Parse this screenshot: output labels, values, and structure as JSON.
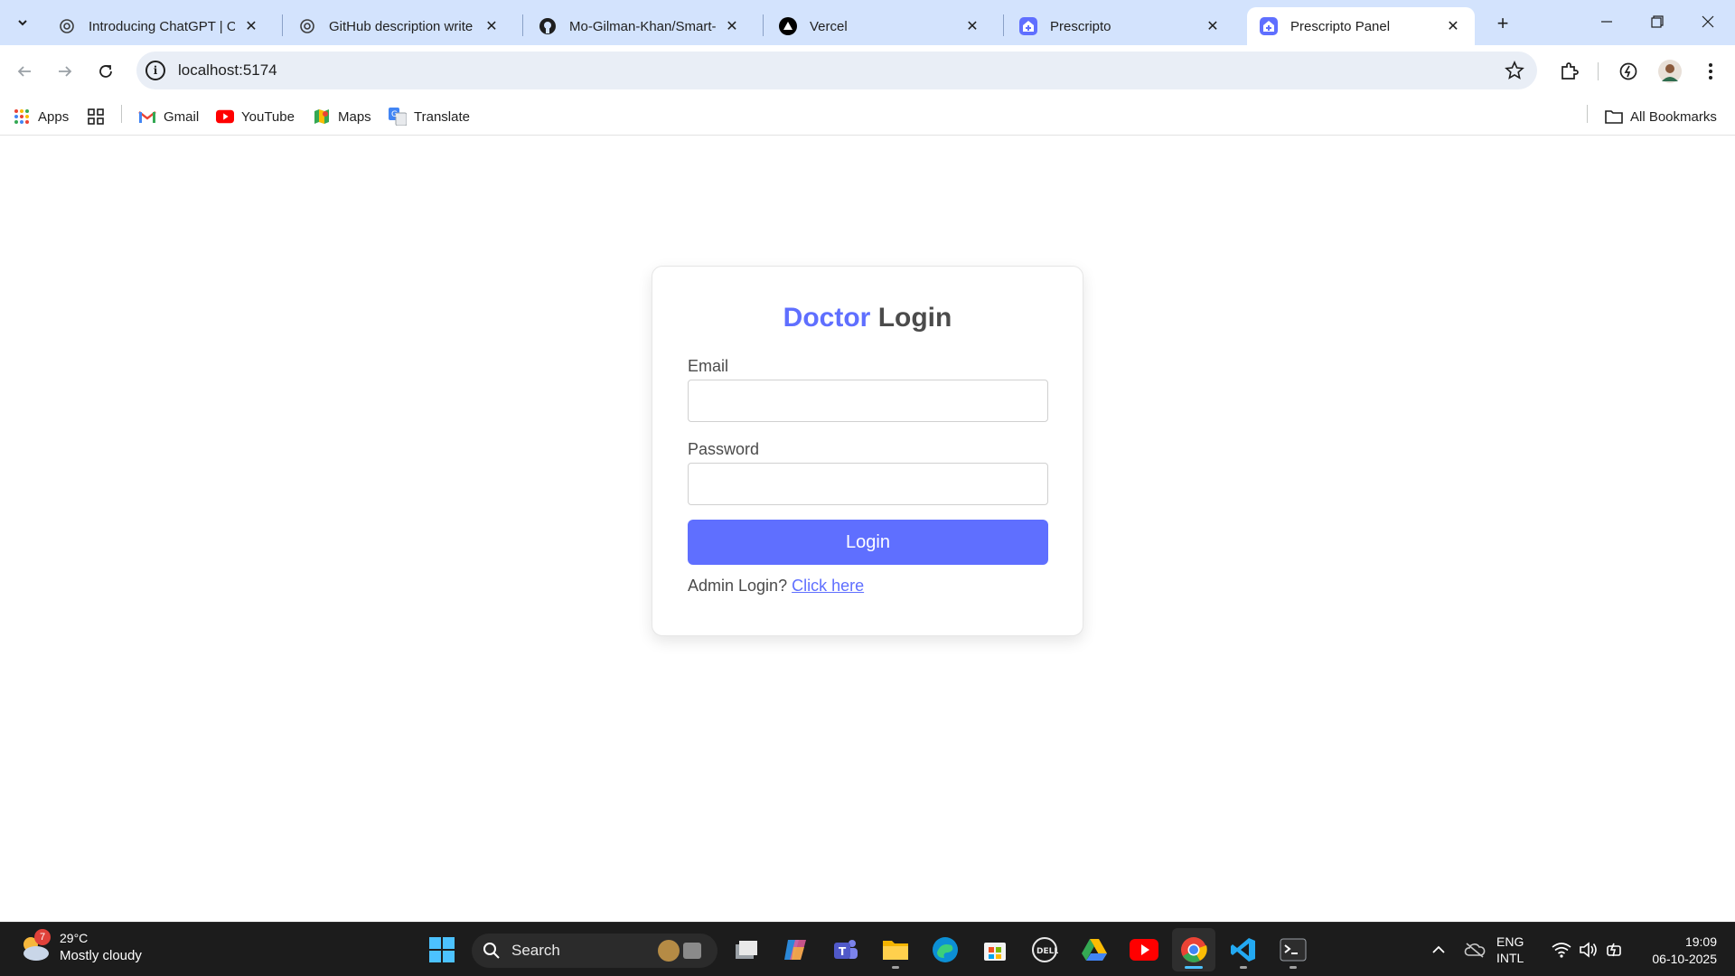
{
  "browser": {
    "tabs": [
      {
        "title": "Introducing ChatGPT | Ope",
        "icon": "chatgpt-icon",
        "active": false
      },
      {
        "title": "GitHub description write",
        "icon": "chatgpt-icon",
        "active": false
      },
      {
        "title": "Mo-Gilman-Khan/Smart-M",
        "icon": "github-icon",
        "active": false
      },
      {
        "title": "Vercel",
        "icon": "vercel-icon",
        "active": false
      },
      {
        "title": "Prescripto",
        "icon": "prescripto-icon",
        "active": false
      },
      {
        "title": "Prescripto Panel",
        "icon": "prescripto-icon",
        "active": true
      }
    ],
    "url": "localhost:5174",
    "bookmarks": [
      {
        "label": "Apps",
        "icon": "apps-grid-icon"
      },
      {
        "label": "Gmail",
        "icon": "gmail-icon"
      },
      {
        "label": "YouTube",
        "icon": "youtube-icon"
      },
      {
        "label": "Maps",
        "icon": "maps-icon"
      },
      {
        "label": "Translate",
        "icon": "translate-icon"
      }
    ],
    "all_bookmarks_label": "All Bookmarks"
  },
  "login": {
    "title_accent": "Doctor",
    "title_rest": "Login",
    "email_label": "Email",
    "email_value": "",
    "password_label": "Password",
    "password_value": "",
    "submit_label": "Login",
    "switch_prompt": "Admin Login?",
    "switch_link": "Click here",
    "accent_color": "#5f6fff"
  },
  "taskbar": {
    "weather": {
      "temp": "29°C",
      "condition": "Mostly cloudy",
      "badge": "7"
    },
    "search_label": "Search",
    "apps": [
      "task-view",
      "copilot",
      "teams",
      "file-explorer",
      "edge",
      "microsoft-store",
      "dell",
      "google-drive",
      "youtube",
      "chrome",
      "vscode",
      "terminal"
    ],
    "lang_line1": "ENG",
    "lang_line2": "INTL",
    "time": "19:09",
    "date": "06-10-2025"
  }
}
